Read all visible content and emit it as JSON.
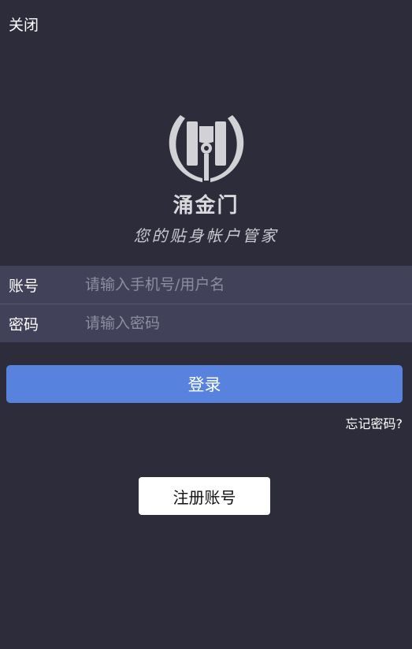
{
  "header": {
    "close_label": "关闭"
  },
  "brand": {
    "name": "涌金门",
    "slogan": "您的贴身帐户管家",
    "logo_icon": "gate-logo-icon",
    "logo_color": "#d1d1d6"
  },
  "form": {
    "account_label": "账号",
    "account_placeholder": "请输入手机号/用户名",
    "account_value": "",
    "password_label": "密码",
    "password_placeholder": "请输入密码",
    "password_value": ""
  },
  "actions": {
    "login_label": "登录",
    "forgot_label": "忘记密码?",
    "register_label": "注册账号"
  },
  "colors": {
    "background": "#2d2c3b",
    "form_background": "#42415a",
    "login_button": "#5783df",
    "register_button": "#ffffff"
  }
}
